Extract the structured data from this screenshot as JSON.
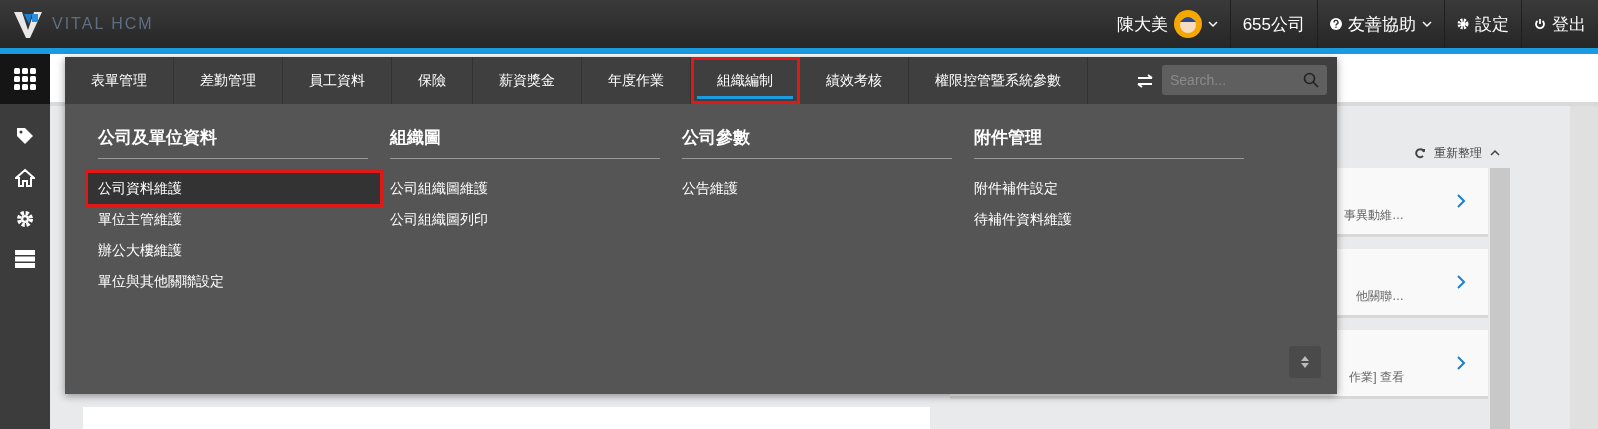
{
  "header": {
    "logo_text": "VITAL HCM",
    "user_name": "陳大美",
    "company": "655公司",
    "help": "友善協助",
    "settings": "設定",
    "logout": "登出"
  },
  "mega_menu": {
    "tabs": [
      {
        "label": "表單管理",
        "selected": false,
        "highlighted": false
      },
      {
        "label": "差勤管理",
        "selected": false,
        "highlighted": false
      },
      {
        "label": "員工資料",
        "selected": false,
        "highlighted": false
      },
      {
        "label": "保險",
        "selected": false,
        "highlighted": false
      },
      {
        "label": "薪資獎金",
        "selected": false,
        "highlighted": false
      },
      {
        "label": "年度作業",
        "selected": false,
        "highlighted": false
      },
      {
        "label": "組織編制",
        "selected": true,
        "highlighted": true
      },
      {
        "label": "績效考核",
        "selected": false,
        "highlighted": false
      },
      {
        "label": "權限控管暨系統參數",
        "selected": false,
        "highlighted": false
      }
    ],
    "search": {
      "placeholder": "Search..."
    },
    "columns": [
      {
        "heading": "公司及單位資料",
        "items": [
          {
            "label": "公司資料維護",
            "selected": true,
            "highlighted": true
          },
          {
            "label": "單位主管維護",
            "selected": false,
            "highlighted": false
          },
          {
            "label": "辦公大樓維護",
            "selected": false,
            "highlighted": false
          },
          {
            "label": "單位與其他關聯設定",
            "selected": false,
            "highlighted": false
          }
        ]
      },
      {
        "heading": "組織圖",
        "items": [
          {
            "label": "公司組織圖維護",
            "selected": false,
            "highlighted": false
          },
          {
            "label": "公司組織圖列印",
            "selected": false,
            "highlighted": false
          }
        ]
      },
      {
        "heading": "公司參數",
        "items": [
          {
            "label": "公告維護",
            "selected": false,
            "highlighted": false
          }
        ]
      },
      {
        "heading": "附件管理",
        "items": [
          {
            "label": "附件補件設定",
            "selected": false,
            "highlighted": false
          },
          {
            "label": "待補件資料維護",
            "selected": false,
            "highlighted": false
          }
        ]
      }
    ]
  },
  "right_panel": {
    "refresh": "重新整理",
    "cards": [
      {
        "text": "事異動維…"
      },
      {
        "text": "他關聯…"
      },
      {
        "text": "作業] 查看"
      }
    ]
  }
}
